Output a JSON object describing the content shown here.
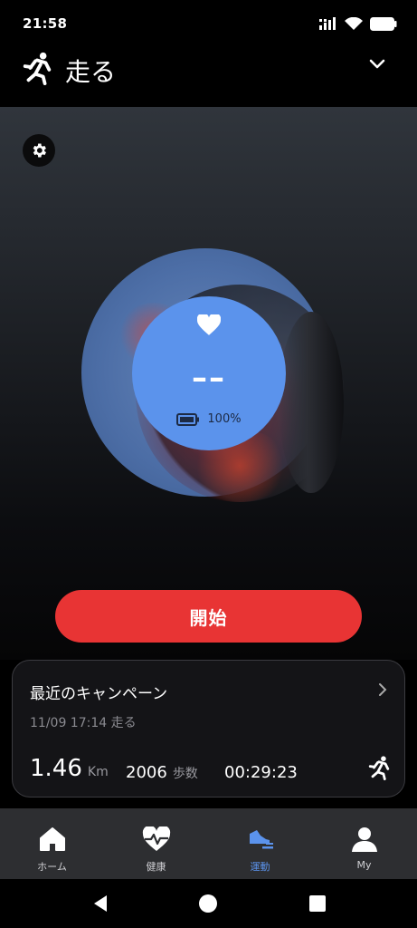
{
  "status": {
    "time": "21:58",
    "battery_level": 1.0
  },
  "header": {
    "title": "走る",
    "run_icon": "running-person-icon",
    "dropdown_icon": "chevron-down-icon"
  },
  "hero": {
    "settings_icon": "gear-icon",
    "heart_icon": "heart-icon",
    "heart_rate": "––",
    "battery_text": "100%",
    "battery_icon": "battery-icon",
    "accent": "#5b93ec"
  },
  "start_button": {
    "label": "開始",
    "color": "#e83434"
  },
  "recent": {
    "title": "最近のキャンペーン",
    "date": "11/09 17:14 走る",
    "distance_value": "1.46",
    "distance_unit": "Km",
    "steps_value": "2006",
    "steps_unit": "歩数",
    "duration": "00:29:23",
    "activity_icon": "running-person-icon"
  },
  "tabs": [
    {
      "label": "ホーム",
      "icon": "home-icon",
      "active": false
    },
    {
      "label": "健康",
      "icon": "health-heart-icon",
      "active": false
    },
    {
      "label": "運動",
      "icon": "sneaker-icon",
      "active": true
    },
    {
      "label": "My",
      "icon": "user-icon",
      "active": false
    }
  ],
  "system_nav": {
    "back": "back-icon",
    "home": "home-circle-icon",
    "recents": "recents-icon"
  }
}
